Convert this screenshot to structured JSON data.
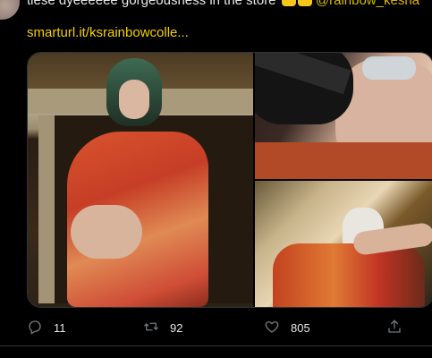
{
  "tweet": {
    "text_visible": "tiese dyeeeeee gorgeousness in the store ",
    "mention_visible": "@rainbow_kesha",
    "link": "smarturl.it/ksrainbowcolle..."
  },
  "actions": {
    "reply_count": "11",
    "retweet_count": "92",
    "like_count": "805"
  },
  "icons": {
    "reply": "reply-icon",
    "retweet": "retweet-icon",
    "like": "heart-icon",
    "share": "share-icon"
  },
  "colors": {
    "background": "#000000",
    "link": "#f4d000",
    "muted": "#71767b",
    "border": "#2f3336"
  }
}
